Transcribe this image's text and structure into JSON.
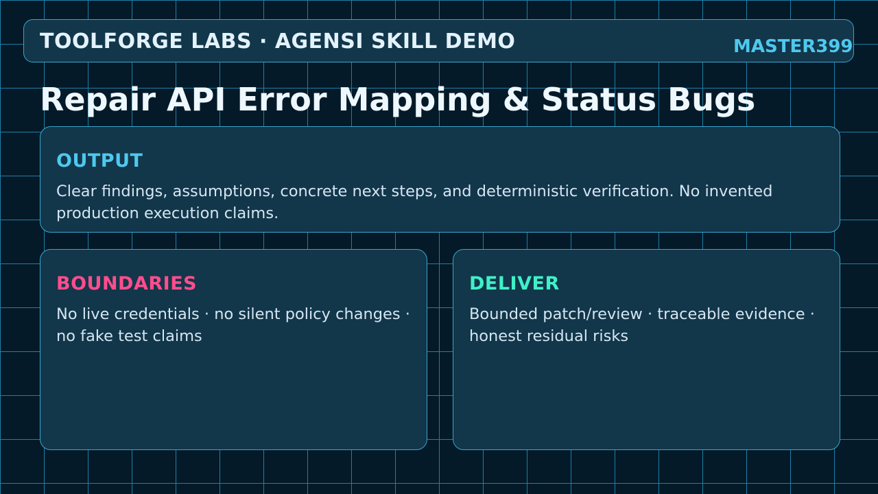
{
  "header": {
    "title": "TOOLFORGE LABS · AGENSI SKILL DEMO",
    "code": "MASTER399"
  },
  "page": {
    "title": "Repair API Error Mapping & Status Bugs"
  },
  "cards": {
    "output": {
      "heading": "OUTPUT",
      "text": "Clear findings, assumptions, concrete next steps, and deterministic verification. No invented production execution claims.",
      "accent": "#4fc8ee"
    },
    "boundaries": {
      "heading": "BOUNDARIES",
      "text": "No live credentials · no silent policy changes · no fake test claims",
      "accent": "#ff4d8d"
    },
    "deliver": {
      "heading": "DELIVER",
      "text": "Bounded patch/review · traceable evidence · honest residual risks",
      "accent": "#3ff0c8"
    }
  },
  "colors": {
    "background": "#041a28",
    "grid": "#1f7fa8",
    "card": "#12364a",
    "border": "#3aa6cf"
  }
}
